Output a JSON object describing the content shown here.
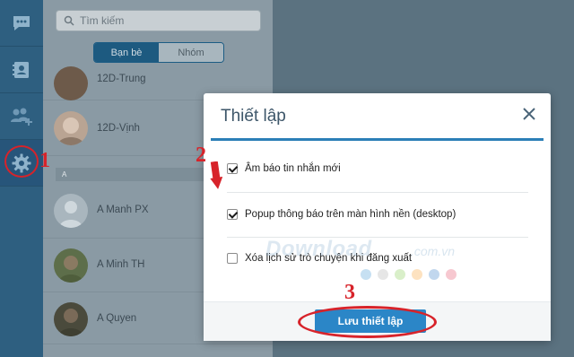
{
  "search": {
    "placeholder": "Tìm kiếm"
  },
  "tabs": {
    "friends": "Bạn bè",
    "groups": "Nhóm"
  },
  "contacts": [
    {
      "name": "12D-Trung"
    },
    {
      "name": "12D-Vịnh"
    },
    {
      "name": "A Manh PX"
    },
    {
      "name": "A Minh TH"
    },
    {
      "name": "A Quyen"
    }
  ],
  "section_letter": "A",
  "dialog": {
    "title": "Thiết lập",
    "options": [
      {
        "label": "Âm báo tin nhắn mới",
        "checked": true
      },
      {
        "label": "Popup thông báo trên màn hình nền (desktop)",
        "checked": true
      },
      {
        "label": "Xóa lịch sử trò chuyện khi đăng xuất",
        "checked": false
      }
    ],
    "save_label": "Lưu thiết lập"
  },
  "watermark": {
    "brand": "Download",
    "domain": ".com.vn"
  },
  "annotations": {
    "step1": "1",
    "step2": "2",
    "step3": "3"
  },
  "colors": {
    "rail": "#2e5f80",
    "accent": "#2b86c7",
    "annotation": "#d7232a",
    "watermark_dots": [
      "#c6e0f2",
      "#e6e6e6",
      "#d9efc9",
      "#fde2c0",
      "#c1d7ee",
      "#f7c8d0"
    ]
  },
  "icons": [
    "chat-icon",
    "contacts-icon",
    "add-friend-icon",
    "gear-icon",
    "search-icon",
    "close-icon"
  ]
}
